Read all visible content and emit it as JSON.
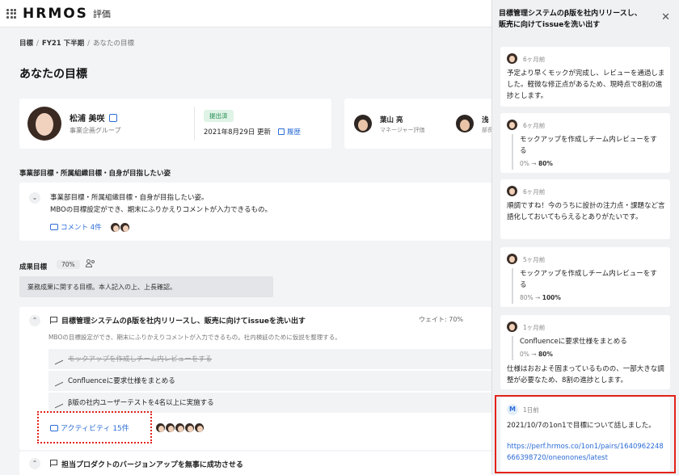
{
  "header": {
    "brand": "HRMOS",
    "product": "評価"
  },
  "breadcrumb": {
    "items": [
      "目標",
      "FY21 下半期"
    ],
    "current": "あなたの目標"
  },
  "page_title": "あなたの目標",
  "profile": {
    "name": "松浦 美咲",
    "group": "事業企画グループ",
    "status": "提出済",
    "updated": "2021年8月29日 更新",
    "history_label": "履歴"
  },
  "reviewers": [
    {
      "name": "葉山 亮",
      "role": "マネージャー評価"
    },
    {
      "name": "浅",
      "role": "部長"
    }
  ],
  "vision": {
    "section_title": "事業部目標・所属組織目標・自身が目指したい姿",
    "lines": [
      "事業部目標・所属組織目標・自身が目指したい姿。",
      "MBOの目標設定ができ、期末にふりかえりコメントが入力できるもの。"
    ],
    "comment_label": "コメント 4件"
  },
  "results": {
    "section_title": "成果目標",
    "percent": "70%",
    "description": "業務成果に関する目標。本人記入の上、上長確認。"
  },
  "goal": {
    "title": "目標管理システムのβ版を社内リリースし、販売に向けてissueを洗い出す",
    "weight": "ウェイト: 70%",
    "description": "MBOの目標設定ができ、期末にふりかえりコメントが入力できるもの。社内検証のために仮説を整理する。",
    "tasks": [
      {
        "label": "モックアップを作成しチーム内レビューをする",
        "done": true
      },
      {
        "label": "Confluenceに要求仕様をまとめる",
        "done": false
      },
      {
        "label": "β版の社内ユーザーテストを4名以上に実施する",
        "done": false
      }
    ],
    "activity_label": "アクティビティ 15件"
  },
  "goal2": {
    "title": "担当プロダクトのバージョンアップを無事に成功させる"
  },
  "panel": {
    "title_line1": "目標管理システムのβ版を社内リリースし、",
    "title_line2": "販売に向けてissueを洗い出す",
    "activities": [
      {
        "time": "6ヶ月前",
        "text": "予定より早くモックが完成し、レビューを通過しました。軽微な修正点があるため、現時点で8割の進捗とします。"
      },
      {
        "time": "6ヶ月前",
        "quote": "モックアップを作成しチーム内レビューをする",
        "progress_from": "0%",
        "progress_to": "80%"
      },
      {
        "time": "6ヶ月前",
        "text": "順調ですね！今のうちに設計の注力点・課題など言語化しておいてもらえるとありがたいです。"
      },
      {
        "time": "5ヶ月前",
        "quote": "モックアップを作成しチーム内レビューをする",
        "progress_from": "80%",
        "progress_to": "100%"
      },
      {
        "time": "1ヶ月前",
        "quote": "Confluenceに要求仕様をまとめる",
        "progress_from": "0%",
        "progress_to": "80%",
        "text": "仕様はおおよそ固まっているものの、一部大きな調整が必要なため、8割の進捗とします。"
      },
      {
        "time": "1日前",
        "text": "2021/10/7の1on1で目標について話しました。",
        "link": "https://perf.hrmos.co/1on1/pairs/1640962248666398720/oneonones/latest"
      }
    ]
  }
}
